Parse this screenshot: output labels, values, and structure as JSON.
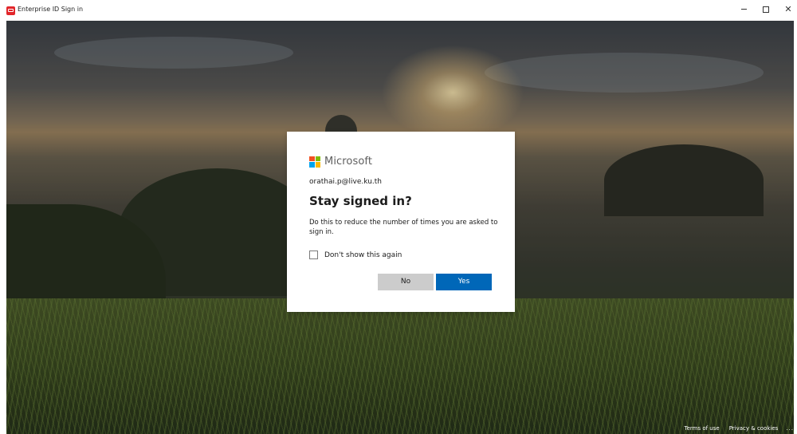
{
  "window": {
    "title": "Enterprise ID Sign in",
    "controls": {
      "minimize": "minimize-icon",
      "maximize": "maximize-icon",
      "close": "✕"
    },
    "app_icon_color": "#e2262b"
  },
  "dialog": {
    "brand": "Microsoft",
    "account": "orathai.p@live.ku.th",
    "heading": "Stay signed in?",
    "description": "Do this to reduce the number of times you are asked to sign in.",
    "checkbox_label": "Don't show this again",
    "checkbox_checked": false,
    "no_label": "No",
    "yes_label": "Yes",
    "colors": {
      "primary": "#0067b8",
      "secondary": "#cccccc"
    }
  },
  "footer": {
    "terms": "Terms of use",
    "privacy": "Privacy & cookies",
    "more": "..."
  }
}
